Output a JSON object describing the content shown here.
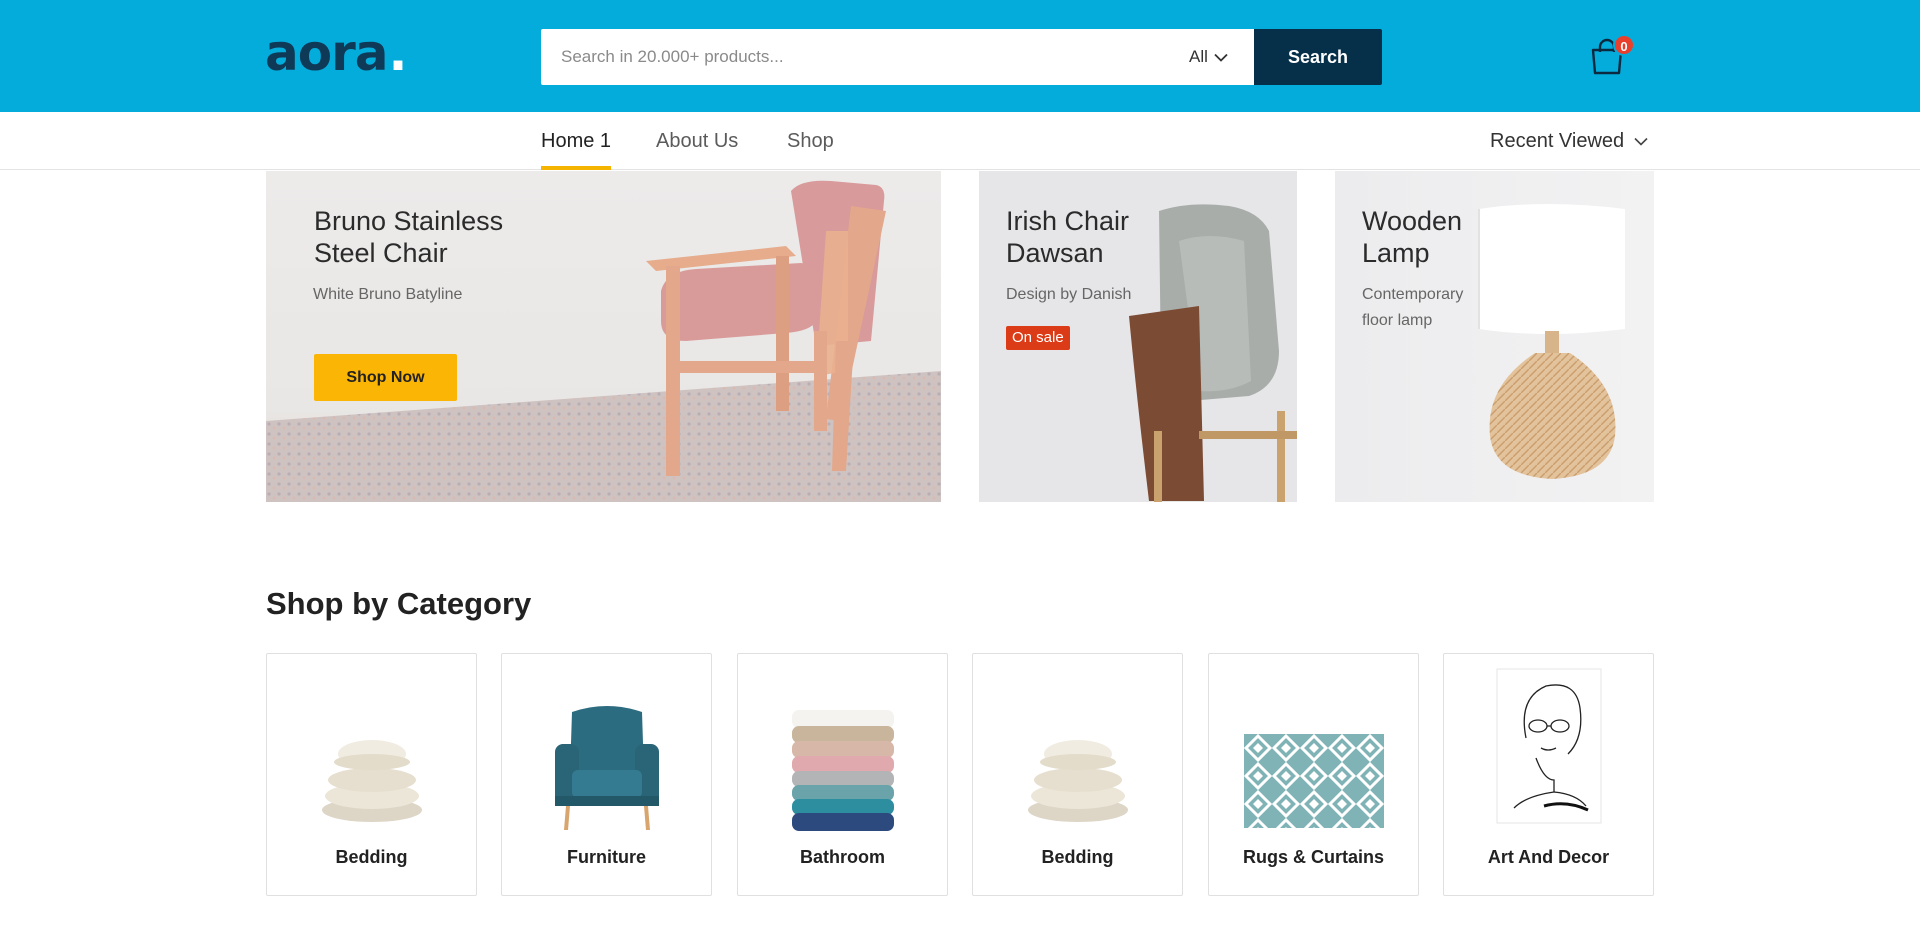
{
  "header": {
    "logo_text": "aora",
    "logo_dot": ".",
    "search_placeholder": "Search in 20.000+ products...",
    "search_category": "All",
    "search_button": "Search",
    "cart_count": "0",
    "brand_color": "#04acdc",
    "button_color": "#06304a"
  },
  "nav": {
    "items": [
      {
        "label": "Home 1",
        "active": true
      },
      {
        "label": "About Us",
        "active": false
      },
      {
        "label": "Shop",
        "active": false
      }
    ],
    "recent_viewed": "Recent Viewed",
    "active_underline_color": "#f5b400"
  },
  "banners": [
    {
      "title_line1": "Bruno Stainless",
      "title_line2": "Steel Chair",
      "subtitle": "White Bruno Batyline",
      "button": "Shop Now"
    },
    {
      "title_line1": "Irish Chair",
      "title_line2": "Dawsan",
      "subtitle": "Design by Danish",
      "badge": "On sale"
    },
    {
      "title_line1": "Wooden",
      "title_line2": "Lamp",
      "subtitle_line1": "Contemporary",
      "subtitle_line2": "floor lamp"
    }
  ],
  "categories": {
    "heading": "Shop by Category",
    "items": [
      {
        "label": "Bedding",
        "icon": "pillow-stack-icon"
      },
      {
        "label": "Furniture",
        "icon": "armchair-icon"
      },
      {
        "label": "Bathroom",
        "icon": "towel-stack-icon"
      },
      {
        "label": "Bedding",
        "icon": "pillow-stack-icon"
      },
      {
        "label": "Rugs & Curtains",
        "icon": "rug-icon"
      },
      {
        "label": "Art And Decor",
        "icon": "line-art-portrait-icon"
      }
    ]
  }
}
